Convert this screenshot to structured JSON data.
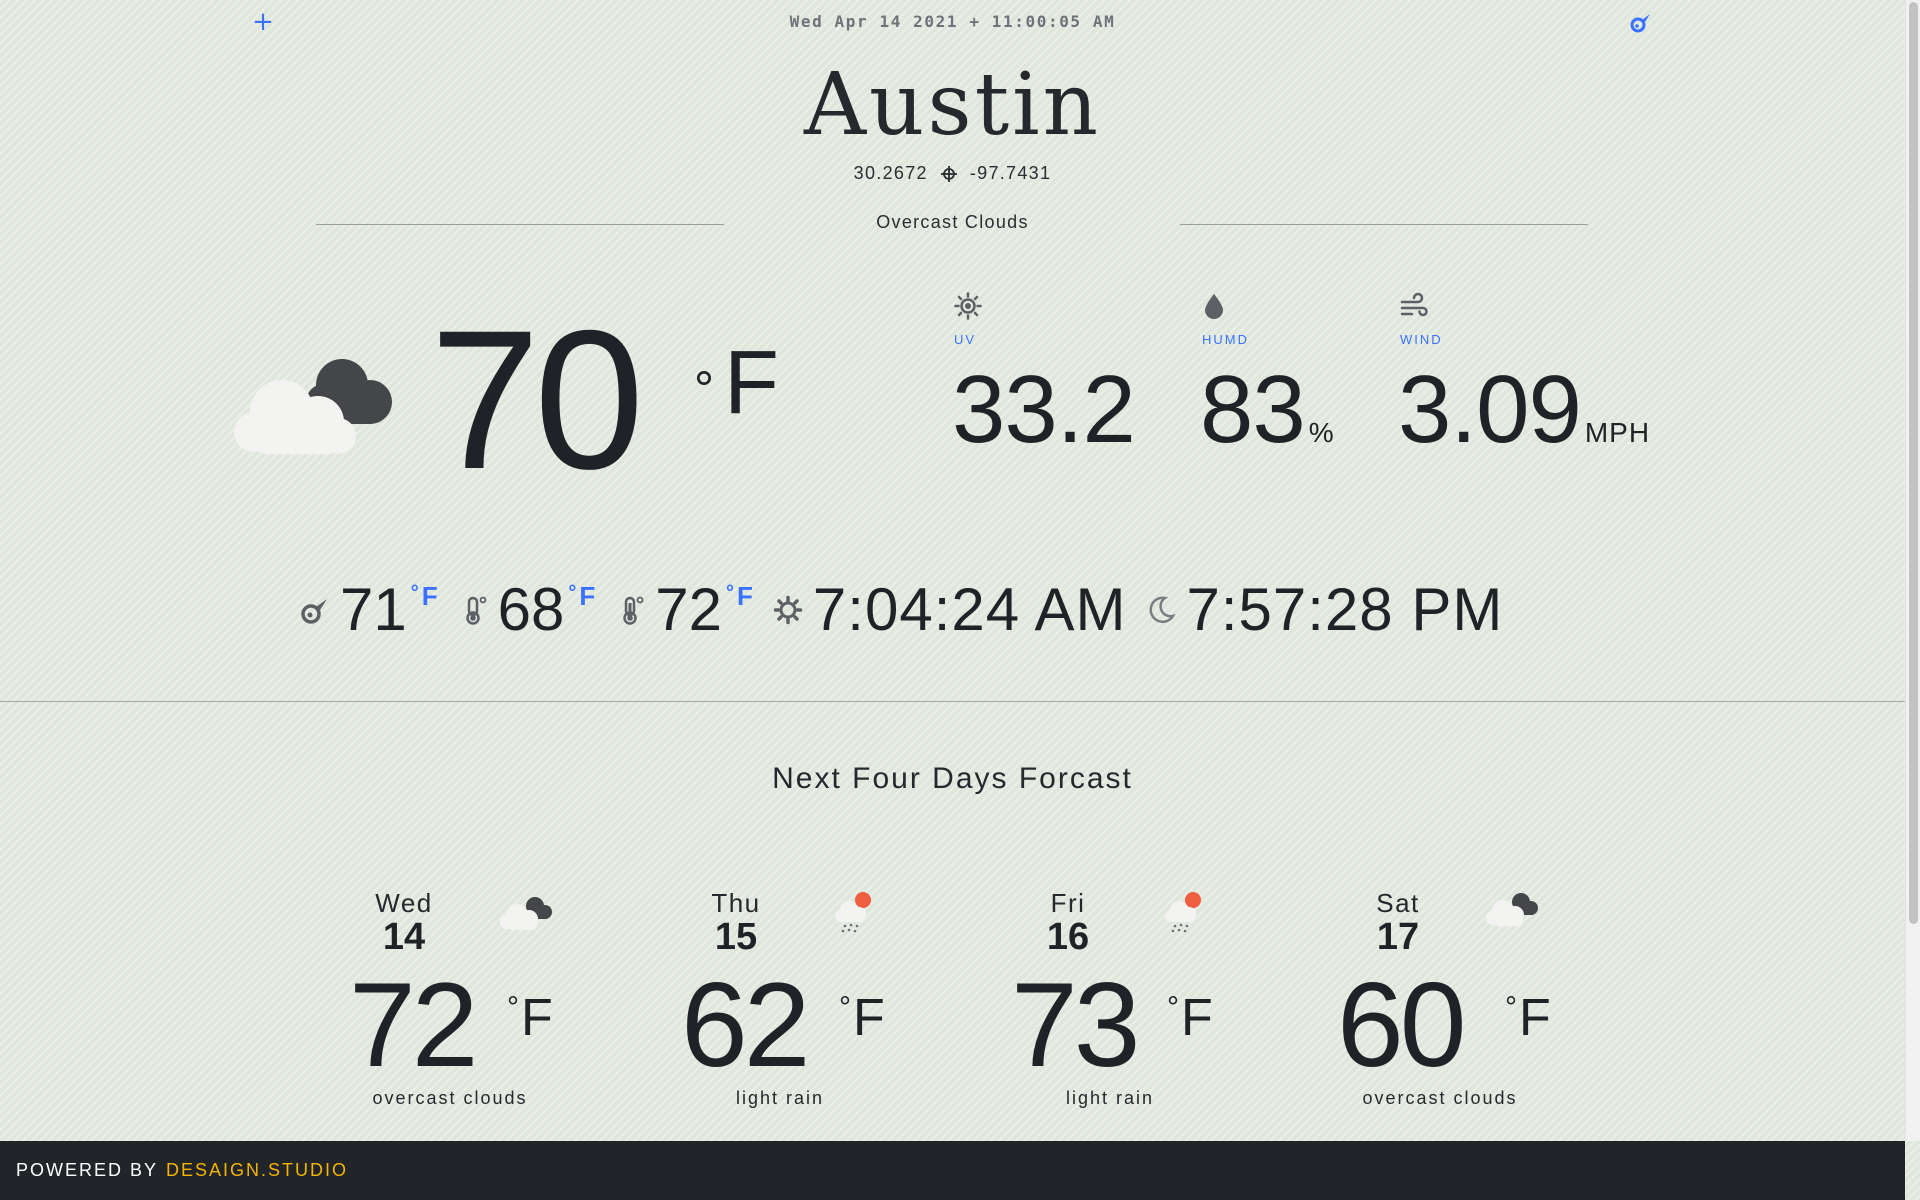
{
  "header": {
    "add_icon": "plus-icon",
    "datetime": "Wed Apr 14 2021 + 11:00:05 AM",
    "location_icon": "meteor-icon"
  },
  "location": {
    "city": "Austin",
    "latitude": "30.2672",
    "longitude": "-97.7431",
    "condition": "Overcast Clouds"
  },
  "current": {
    "icon": "overcast-clouds-icon",
    "temperature": "70",
    "degree": "°",
    "unit": "F",
    "uv": {
      "label": "UV",
      "value": "33.2",
      "unit": "",
      "icon": "sun-icon"
    },
    "humidity": {
      "label": "HUMD",
      "value": "83",
      "unit": "%",
      "icon": "droplet-icon"
    },
    "wind": {
      "label": "WIND",
      "value": "3.09",
      "unit": "MPH",
      "icon": "wind-icon"
    }
  },
  "details": {
    "feels_like": {
      "value": "71",
      "unit": "F",
      "degree": "°",
      "icon": "meteor-icon"
    },
    "temp_min": {
      "value": "68",
      "unit": "F",
      "degree": "°",
      "icon": "thermometer-low-icon"
    },
    "temp_max": {
      "value": "72",
      "unit": "F",
      "degree": "°",
      "icon": "thermometer-high-icon"
    },
    "sunrise": {
      "value": "7:04:24 AM",
      "icon": "sunrise-gear-icon"
    },
    "sunset": {
      "value": "7:57:28 PM",
      "icon": "moon-icon"
    }
  },
  "forecast": {
    "title": "Next Four Days Forcast",
    "days": [
      {
        "day": "Wed",
        "date": "14",
        "temp": "72",
        "degree": "°",
        "unit": "F",
        "desc": "overcast clouds",
        "icon": "overcast-clouds-icon"
      },
      {
        "day": "Thu",
        "date": "15",
        "temp": "62",
        "degree": "°",
        "unit": "F",
        "desc": "light rain",
        "icon": "light-rain-icon"
      },
      {
        "day": "Fri",
        "date": "16",
        "temp": "73",
        "degree": "°",
        "unit": "F",
        "desc": "light rain",
        "icon": "light-rain-icon"
      },
      {
        "day": "Sat",
        "date": "17",
        "temp": "60",
        "degree": "°",
        "unit": "F",
        "desc": "overcast clouds",
        "icon": "overcast-clouds-icon"
      }
    ]
  },
  "footer": {
    "powered_by": "POWERED BY",
    "brand": "DESAIGN.STUDIO"
  },
  "colors": {
    "accent": "#3a72ff",
    "brand": "#f5b400",
    "footer_bg": "#212428",
    "page_bg": "#dfe6dc"
  }
}
